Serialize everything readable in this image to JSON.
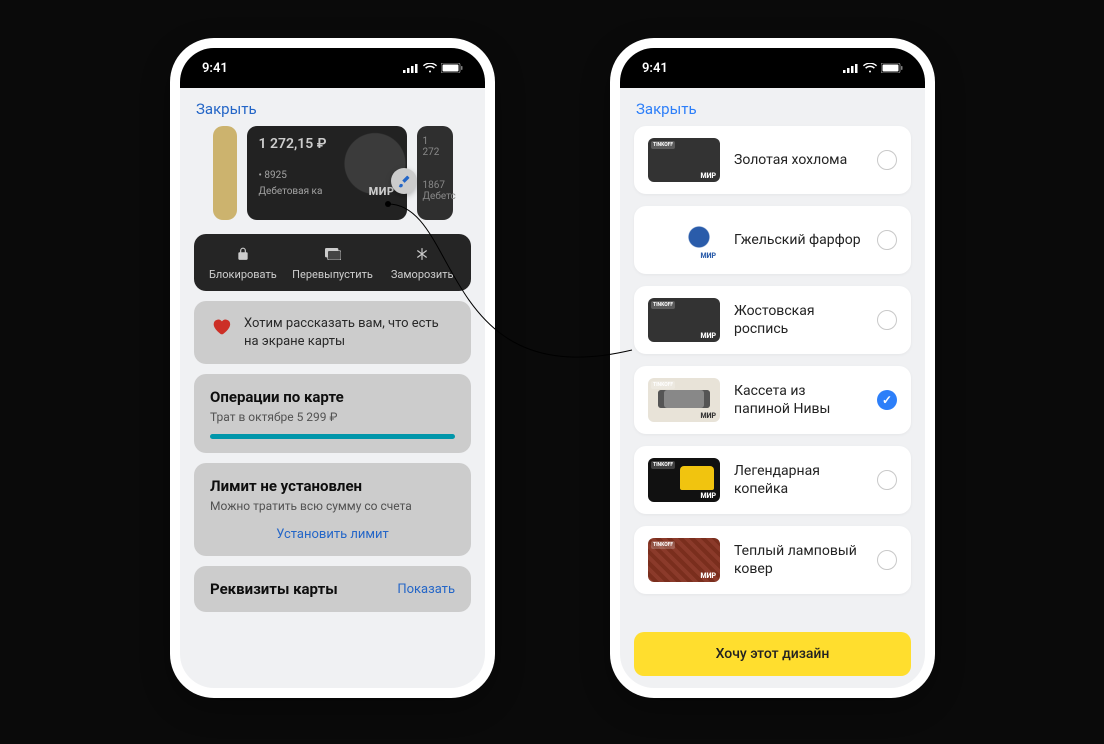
{
  "status": {
    "time": "9:41"
  },
  "left": {
    "close": "Закрыть",
    "card": {
      "balance": "1 272,15 ₽",
      "last4": "• 8925",
      "type": "Дебетовая ка",
      "scheme": "МИР"
    },
    "peek_balance": "1 272",
    "peek_last4": "1867",
    "peek_type": "Дебетс",
    "actions": {
      "block": "Блокировать",
      "reissue": "Перевыпустить",
      "freeze": "Заморозить"
    },
    "hint": "Хотим рассказать вам, что есть на экране карты",
    "ops": {
      "title": "Операции по карте",
      "sub": "Трат в октябре 5 299 ₽"
    },
    "limit": {
      "title": "Лимит не установлен",
      "sub": "Можно тратить всю сумму со счета",
      "set": "Установить лимит"
    },
    "req": {
      "title": "Реквизиты карты",
      "show": "Показать"
    }
  },
  "right": {
    "close": "Закрыть",
    "designs": [
      {
        "label": "Золотая хохлома",
        "selected": false,
        "thumb": "hohloma"
      },
      {
        "label": "Гжельский фарфор",
        "selected": false,
        "thumb": "gzhel"
      },
      {
        "label": "Жостовская роспись",
        "selected": false,
        "thumb": "zhostovo"
      },
      {
        "label": "Кассета из папиной Нивы",
        "selected": true,
        "thumb": "kasseta"
      },
      {
        "label": "Легендарная копейка",
        "selected": false,
        "thumb": "kopeika"
      },
      {
        "label": "Теплый ламповый ковер",
        "selected": false,
        "thumb": "kover"
      }
    ],
    "cta": "Хочу этот дизайн"
  }
}
